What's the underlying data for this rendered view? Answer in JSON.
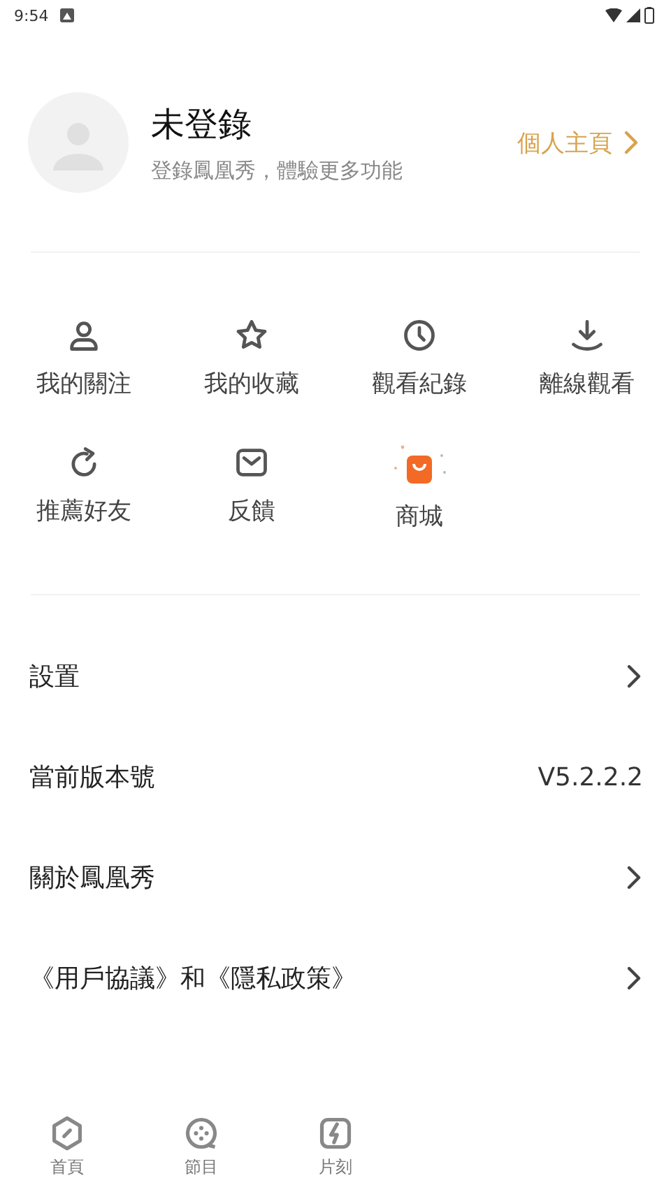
{
  "status_bar": {
    "time": "9:54"
  },
  "profile": {
    "name": "未登錄",
    "subtitle": "登錄鳳凰秀，體驗更多功能",
    "homepage_link": "個人主頁"
  },
  "shortcuts": [
    {
      "kind": "person",
      "label": "我的關注"
    },
    {
      "kind": "star",
      "label": "我的收藏"
    },
    {
      "kind": "clock",
      "label": "觀看紀錄"
    },
    {
      "kind": "download",
      "label": "離線觀看"
    },
    {
      "kind": "share",
      "label": "推薦好友"
    },
    {
      "kind": "mail",
      "label": "反饋"
    },
    {
      "kind": "shop",
      "label": "商城"
    }
  ],
  "menu": [
    {
      "kind": "link",
      "label": "設置"
    },
    {
      "kind": "value",
      "label": "當前版本號",
      "value": "V5.2.2.2"
    },
    {
      "kind": "link",
      "label": "關於鳳凰秀"
    },
    {
      "kind": "link",
      "label": "《用戶協議》和《隱私政策》"
    }
  ],
  "bottom_nav": [
    {
      "kind": "home",
      "label": "首頁",
      "selected": false
    },
    {
      "kind": "reel",
      "label": "節目",
      "selected": false
    },
    {
      "kind": "bolt",
      "label": "片刻",
      "selected": false
    }
  ]
}
